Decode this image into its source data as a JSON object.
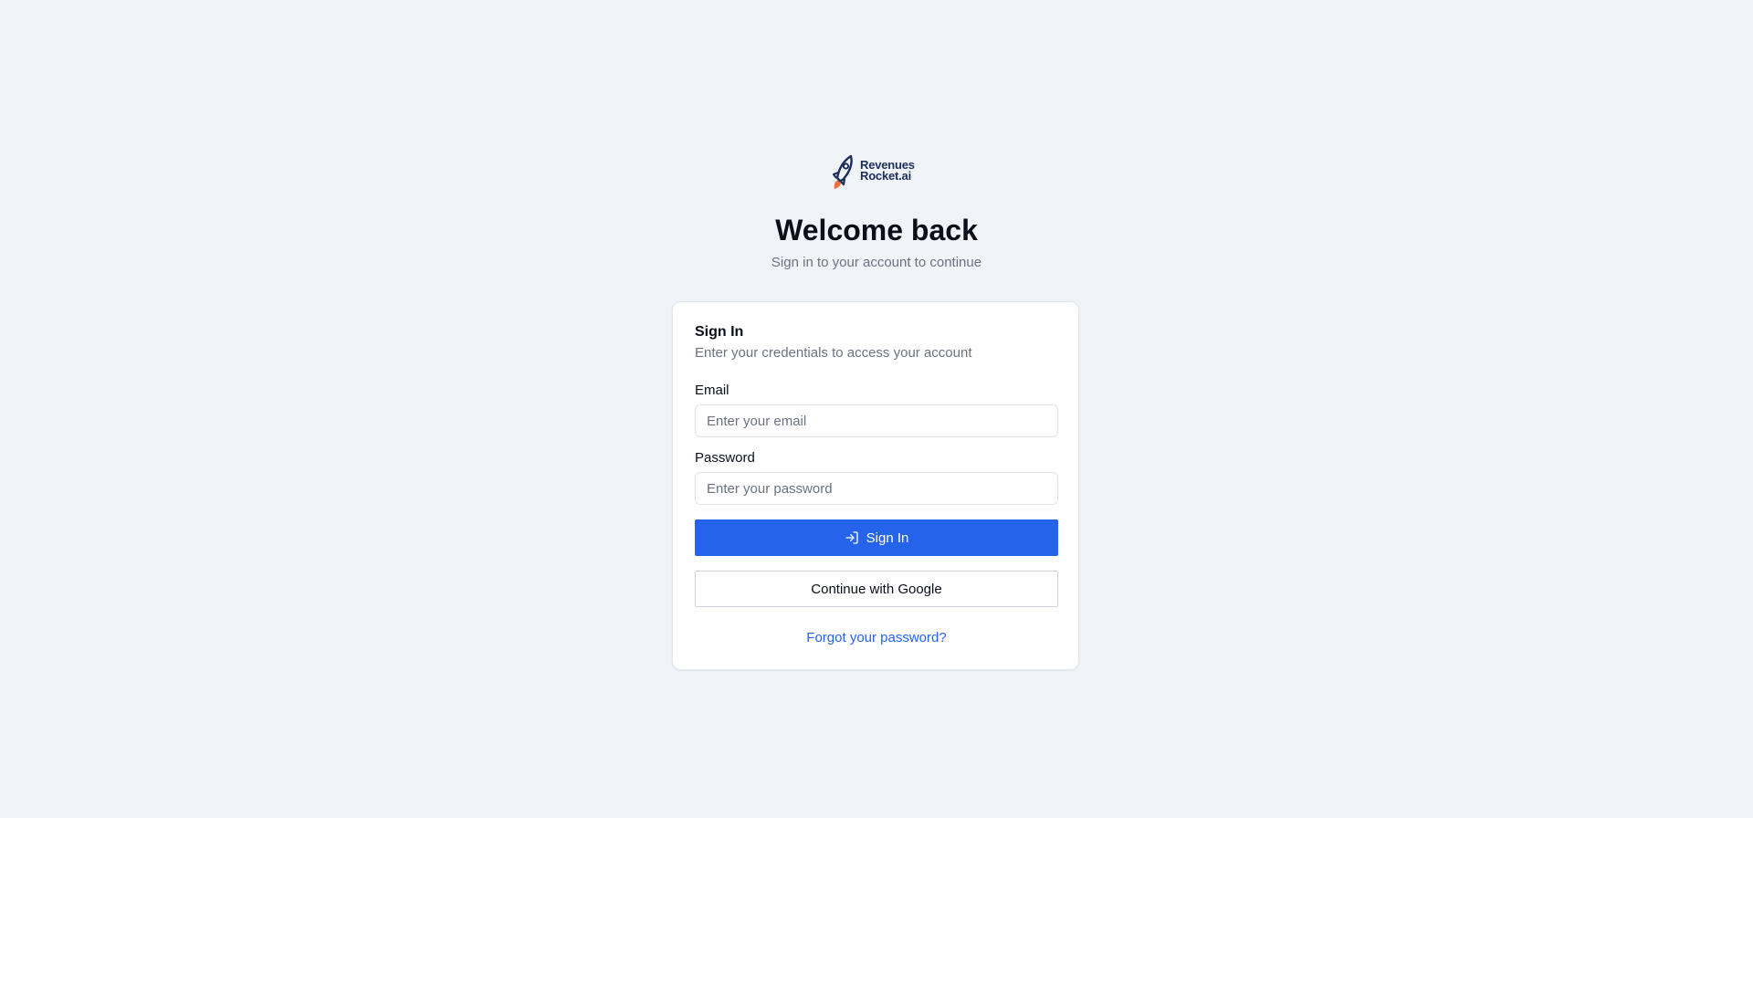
{
  "brand": {
    "logo_line1": "Revenues",
    "logo_line2": "Rocket.ai",
    "icon": "rocket-icon",
    "colors": {
      "navy": "#1c2e5c",
      "flame": "#f26b3a"
    }
  },
  "header": {
    "title": "Welcome back",
    "subtitle": "Sign in to your account to continue"
  },
  "card": {
    "title": "Sign In",
    "description": "Enter your credentials to access your account",
    "email": {
      "label": "Email",
      "placeholder": "Enter your email",
      "value": ""
    },
    "password": {
      "label": "Password",
      "placeholder": "Enter your password",
      "value": ""
    },
    "sign_in_button": {
      "label": "Sign In",
      "icon": "log-in-icon"
    },
    "google_button": {
      "label": "Continue with Google"
    },
    "forgot_link": "Forgot your password?"
  },
  "colors": {
    "background": "#f0f4f8",
    "primary": "#2563eb",
    "muted_text": "#6b7280",
    "text": "#0b0f19"
  }
}
